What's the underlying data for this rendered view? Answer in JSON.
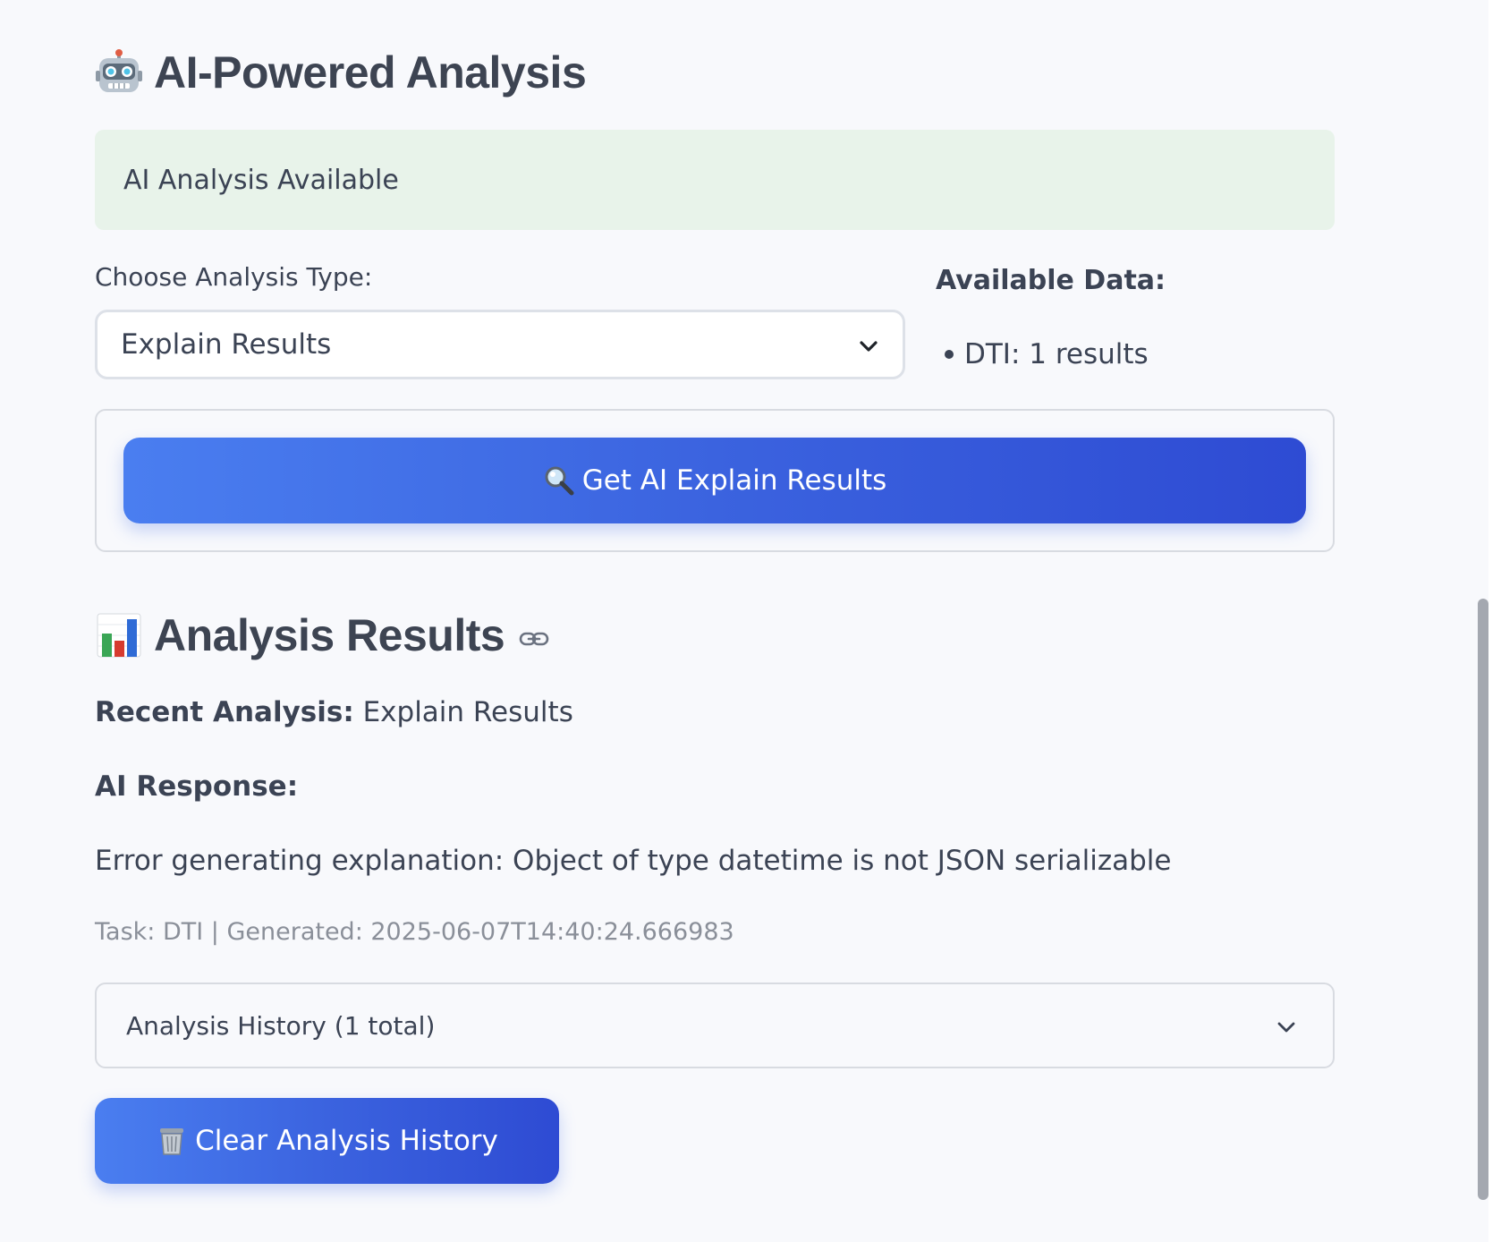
{
  "ai_section": {
    "title": "AI-Powered Analysis",
    "status_text": "AI Analysis Available",
    "choose_label": "Choose Analysis Type:",
    "selected_type": "Explain Results",
    "available_title": "Available Data:",
    "available_items": [
      "DTI: 1 results"
    ],
    "get_button_label": "Get AI Explain Results"
  },
  "results_section": {
    "title": "Analysis Results",
    "recent_label": "Recent Analysis:",
    "recent_value": "Explain Results",
    "ai_response_label": "AI Response:",
    "ai_response_text": "Error generating explanation: Object of type datetime is not JSON serializable",
    "meta_text": "Task: DTI | Generated: 2025-06-07T14:40:24.666983",
    "history_label": "Analysis History (1 total)",
    "clear_button_label": "Clear Analysis History"
  },
  "icons": {
    "title_icon": "robot-icon",
    "results_icon": "bar-chart-icon",
    "button_icon": "magnifier-icon",
    "clear_icon": "wastebasket-icon",
    "anchor_icon": "link-icon",
    "dropdown_icon": "chevron-down-icon"
  },
  "colors": {
    "status_bg": "#e8f3ea",
    "button_gradient_start": "#4a7ef0",
    "button_gradient_end": "#2e4bd3",
    "heading_text": "#3d4452",
    "meta_text": "#8a8f99"
  }
}
